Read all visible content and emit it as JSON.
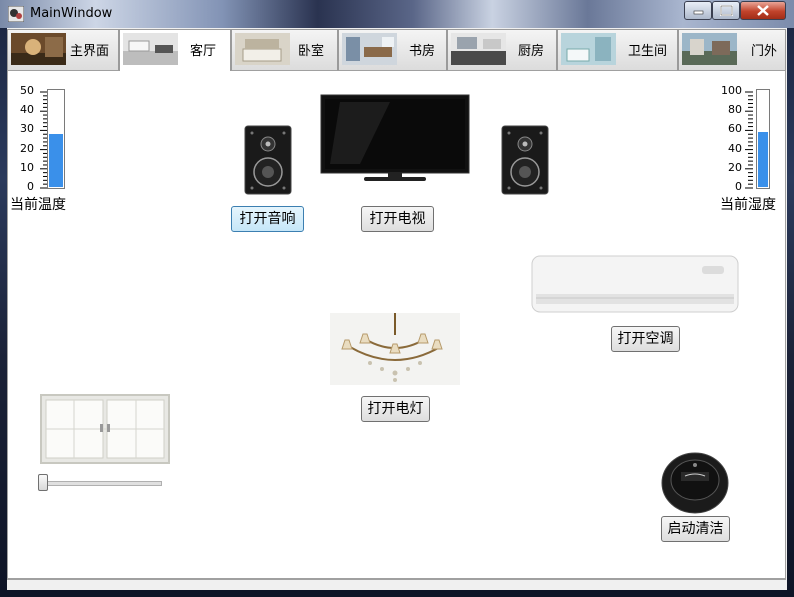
{
  "window": {
    "title": "MainWindow"
  },
  "tabs": [
    {
      "label": "主界面",
      "active": false
    },
    {
      "label": "客厅",
      "active": true
    },
    {
      "label": "卧室",
      "active": false
    },
    {
      "label": "书房",
      "active": false
    },
    {
      "label": "厨房",
      "active": false
    },
    {
      "label": "卫生间",
      "active": false
    },
    {
      "label": "门外",
      "active": false
    }
  ],
  "temperature": {
    "caption": "当前温度",
    "ticks": [
      "50",
      "40",
      "30",
      "20",
      "10",
      "0"
    ],
    "max": 50,
    "value": 27
  },
  "humidity": {
    "caption": "当前湿度",
    "ticks": [
      "100",
      "80",
      "60",
      "40",
      "20",
      "0"
    ],
    "max": 100,
    "value": 56
  },
  "buttons": {
    "speaker": "打开音响",
    "tv": "打开电视",
    "ac": "打开空调",
    "light": "打开电灯",
    "robot": "启动清洁"
  },
  "window_slider": {
    "value": 0
  },
  "colors": {
    "accent": "#3a90ea",
    "hover_border": "#3c7fb1"
  }
}
